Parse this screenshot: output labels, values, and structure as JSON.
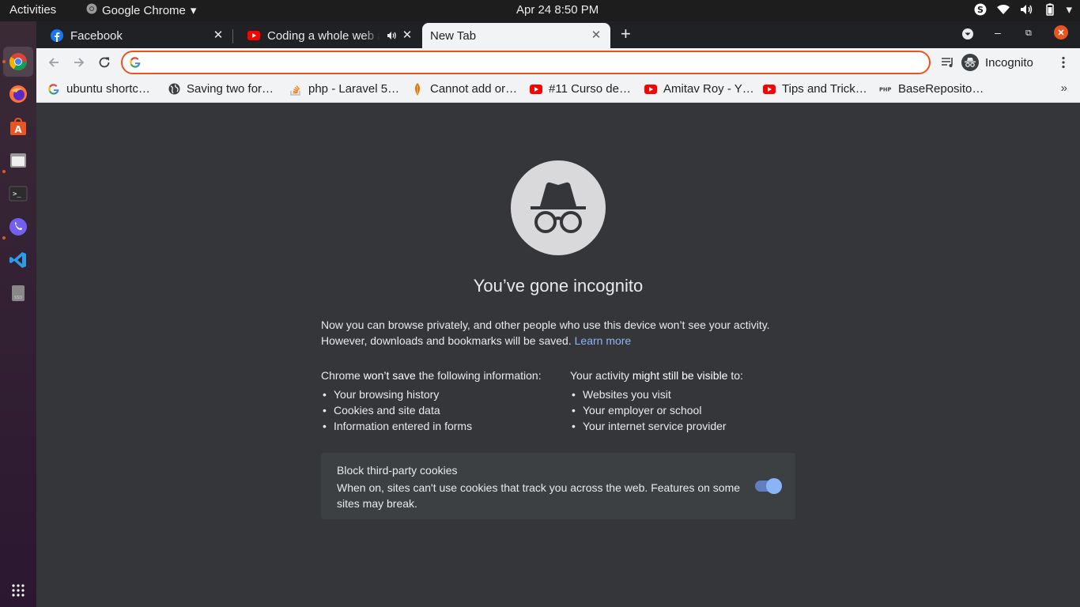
{
  "topbar": {
    "activities": "Activities",
    "app_name": "Google Chrome",
    "clock": "Apr 24  8:50 PM"
  },
  "dock": {
    "items": [
      "chrome-icon",
      "firefox-icon",
      "software-center-icon",
      "files-icon",
      "terminal-icon",
      "viber-icon",
      "vscode-icon",
      "drive-icon",
      "app-grid-icon"
    ]
  },
  "tabs": [
    {
      "title": "Facebook",
      "icon": "facebook-icon"
    },
    {
      "title": "Coding a whole web ap",
      "icon": "youtube-icon",
      "audio": true
    },
    {
      "title": "New Tab",
      "icon": "",
      "active": true
    }
  ],
  "toolbar": {
    "omnibox_value": "",
    "profile_label": "Incognito"
  },
  "bookmarks": [
    {
      "label": "ubuntu shortc…",
      "icon": "google-icon"
    },
    {
      "label": "Saving two for…",
      "icon": "globe-icon"
    },
    {
      "label": "php - Laravel 5…",
      "icon": "stackoverflow-icon"
    },
    {
      "label": "Cannot add or…",
      "icon": "leaf-icon"
    },
    {
      "label": "#11 Curso de…",
      "icon": "youtube-icon"
    },
    {
      "label": "Amitav Roy - Y…",
      "icon": "youtube-icon"
    },
    {
      "label": "Tips and Trick…",
      "icon": "youtube-icon"
    },
    {
      "label": "BaseReposito…",
      "icon": "php-icon"
    }
  ],
  "content": {
    "headline": "You’ve gone incognito",
    "para_line1": "Now you can browse privately, and other people who use this device won’t see your activity.",
    "para_line2": "However, downloads and bookmarks will be saved.",
    "learn_more": "Learn more",
    "left_head_a": "Chrome ",
    "left_head_b": "won’t save",
    "left_head_c": " the following information:",
    "left_items": [
      "Your browsing history",
      "Cookies and site data",
      "Information entered in forms"
    ],
    "right_head_a": "Your activity ",
    "right_head_b": "might still be visible",
    "right_head_c": " to:",
    "right_items": [
      "Websites you visit",
      "Your employer or school",
      "Your internet service provider"
    ],
    "cookie_title": "Block third-party cookies",
    "cookie_desc": "When on, sites can't use cookies that track you across the web. Features on some sites may break.",
    "cookie_toggle_on": true
  }
}
